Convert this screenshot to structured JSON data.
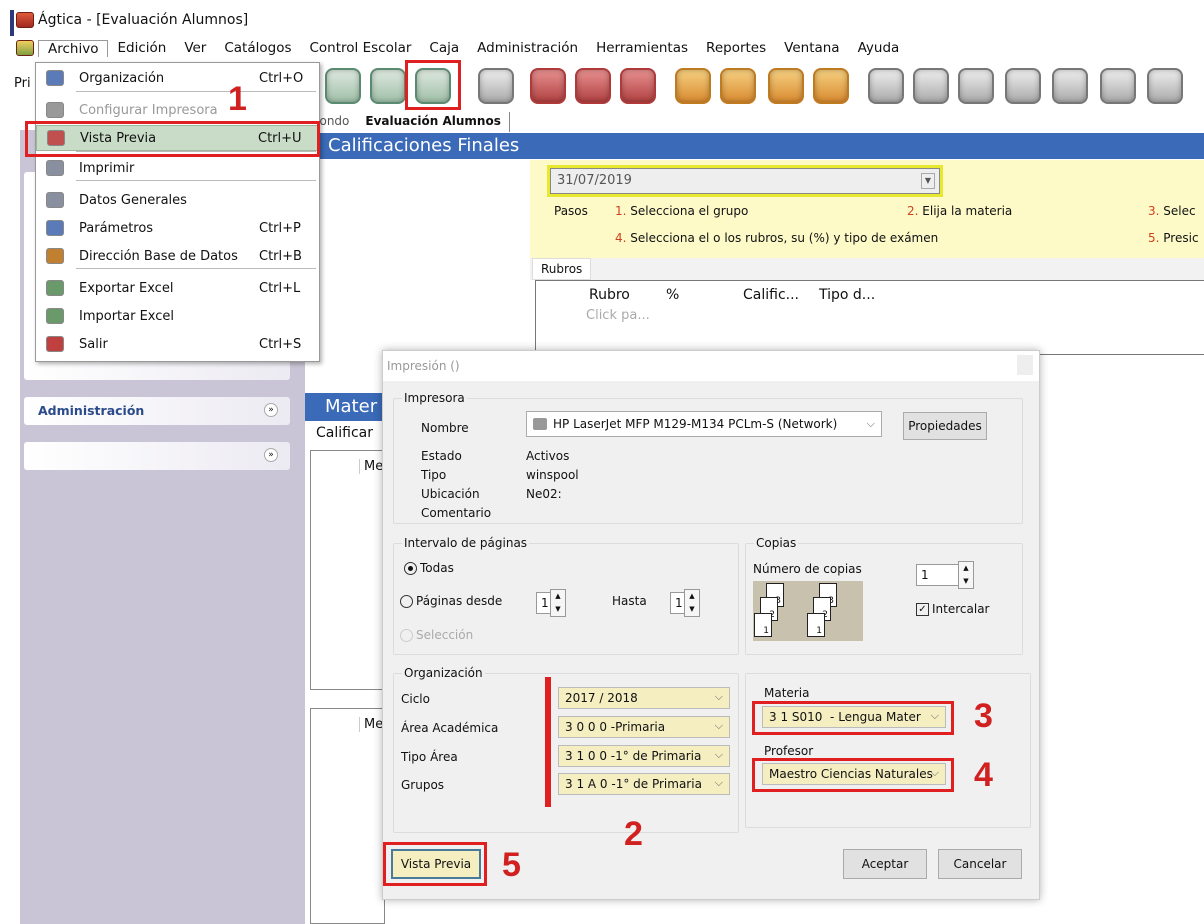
{
  "window": {
    "title": "Ágtica - [Evaluación Alumnos]"
  },
  "menubar": [
    "Archivo",
    "Edición",
    "Ver",
    "Catálogos",
    "Control Escolar",
    "Caja",
    "Administración",
    "Herramientas",
    "Reportes",
    "Ventana",
    "Ayuda"
  ],
  "toolbar": {
    "left_label": "Pri",
    "icons": [
      "card-icon",
      "clock-icon",
      "evaluation-icon",
      "calendar-icon",
      "students-icon",
      "group-icon",
      "id-card-icon",
      "chart-icon",
      "approve-icon",
      "upload-icon",
      "check-icon",
      "report-1-icon",
      "report-2-icon",
      "report-3-icon",
      "report-4-icon",
      "report-5-icon",
      "report-6-icon",
      "report-7-icon"
    ]
  },
  "tabs": [
    "Fondo",
    "Evaluación Alumnos"
  ],
  "archivo_menu": [
    {
      "label": "Organización",
      "shortcut": "Ctrl+O"
    },
    {
      "label": "Configurar Impresora",
      "shortcut": "",
      "disabled": true
    },
    {
      "label": "Vista Previa",
      "shortcut": "Ctrl+U",
      "highlighted": true
    },
    {
      "label": "Imprimir",
      "shortcut": ""
    },
    {
      "label": "Datos Generales",
      "shortcut": ""
    },
    {
      "label": "Parámetros",
      "shortcut": "Ctrl+P"
    },
    {
      "label": "Dirección Base de Datos",
      "shortcut": "Ctrl+B"
    },
    {
      "label": "Exportar Excel",
      "shortcut": "Ctrl+L"
    },
    {
      "label": "Importar Excel",
      "shortcut": ""
    },
    {
      "label": "Salir",
      "shortcut": "Ctrl+S"
    }
  ],
  "sidebar": {
    "admin": "Administración"
  },
  "main": {
    "header": "Calificaciones Finales",
    "date": "31/07/2019",
    "steps_label": "Pasos",
    "steps": [
      {
        "n": "1.",
        "t": "Selecciona el grupo"
      },
      {
        "n": "2.",
        "t": "Elija la materia"
      },
      {
        "n": "3.",
        "t": "Selec"
      },
      {
        "n": "4.",
        "t": "Selecciona el o los rubros, su (%) y tipo de exámen"
      },
      {
        "n": "5.",
        "t": "Presic"
      }
    ],
    "rubros_tab": "Rubros",
    "rubros_columns": [
      "Rubro",
      "%",
      "Calific...",
      "Tipo d..."
    ],
    "rubros_placeholder": "Click pa...",
    "materias_header": "Mater",
    "calificar": "Calificar",
    "grid_col": "Me"
  },
  "dialog": {
    "title": "Impresión ()",
    "impresora": {
      "caption": "Impresora",
      "nombre_label": "Nombre",
      "nombre": "HP LaserJet MFP M129-M134 PCLm-S (Network)",
      "propiedades": "Propiedades",
      "estado_label": "Estado",
      "estado": "Activos",
      "tipo_label": "Tipo",
      "tipo": "winspool",
      "ubicacion_label": "Ubicación",
      "ubicacion": "Ne02:",
      "comentario_label": "Comentario"
    },
    "intervalo": {
      "caption": "Intervalo de páginas",
      "todas": "Todas",
      "desde": "Páginas desde",
      "desde_val": "1",
      "hasta": "Hasta",
      "hasta_val": "1",
      "seleccion": "Selección"
    },
    "copias": {
      "caption": "Copias",
      "numero_label": "Número de copias",
      "numero": "1",
      "intercalar": "Intercalar",
      "intercalar_checked": true
    },
    "organizacion": {
      "caption": "Organización",
      "ciclo_label": "Ciclo",
      "ciclo": "2017 / 2018",
      "area_label": "Área Académica",
      "area": "3 0 0 0 -Primaria",
      "tipo_label": "Tipo Área",
      "tipo": "3 1 0 0 -1° de Primaria",
      "grupos_label": "Grupos",
      "grupos": "3 1 A 0 -1° de Primaria"
    },
    "materia_label": "Materia",
    "materia": "3 1 S010  - Lengua Mater",
    "profesor_label": "Profesor",
    "profesor": "Maestro Ciencias Naturales",
    "vista_previa": "Vista Previa",
    "aceptar": "Aceptar",
    "cancelar": "Cancelar"
  },
  "annotations": [
    "1",
    "2",
    "3",
    "4",
    "5"
  ],
  "colors": {
    "highlight": "#e02020",
    "header_blue": "#3a6ab8",
    "yellow_panel": "#fdfac8",
    "sidebar": "#cac5d6"
  }
}
